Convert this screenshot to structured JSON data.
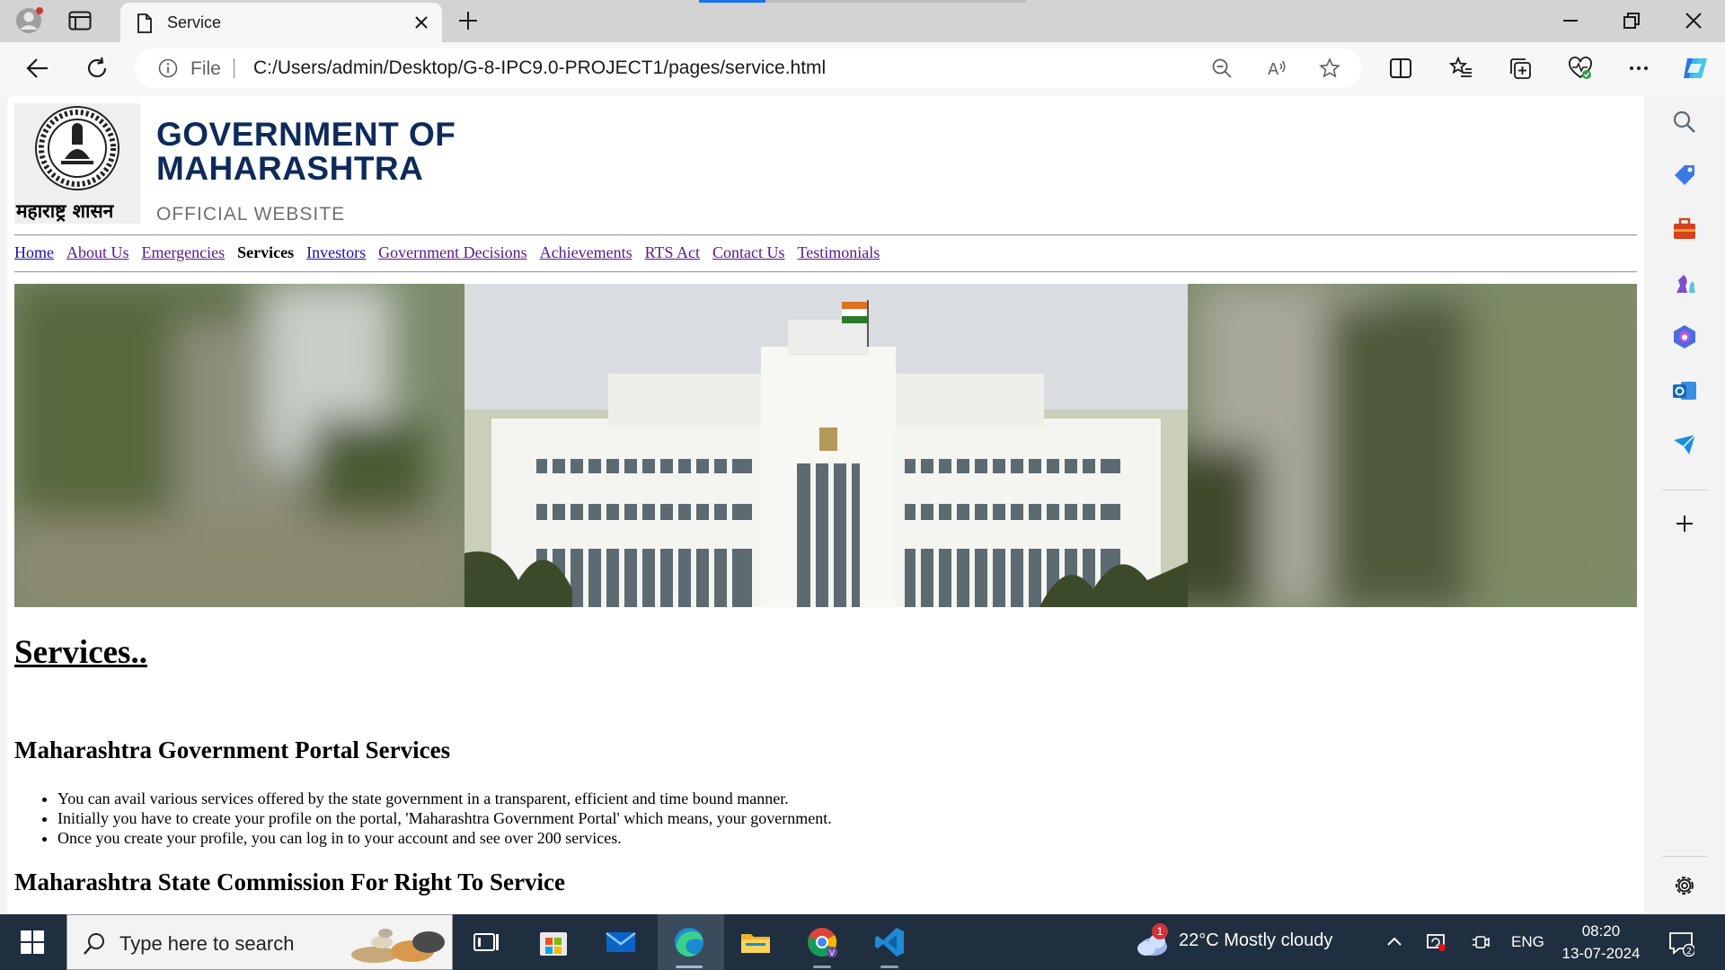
{
  "browser": {
    "tab_title": "Service",
    "address": {
      "scheme_label": "File",
      "url": "C:/Users/admin/Desktop/G-8-IPC9.0-PROJECT1/pages/service.html"
    }
  },
  "site": {
    "marathi_name": "महाराष्ट्र शासन",
    "title": "GOVERNMENT OF\nMAHARASHTRA",
    "subtitle": "OFFICIAL WEBSITE",
    "nav": [
      {
        "label": "Home"
      },
      {
        "label": "About Us"
      },
      {
        "label": "Emergencies"
      },
      {
        "label": "Services",
        "current": true
      },
      {
        "label": "Investors"
      },
      {
        "label": "Government Decisions"
      },
      {
        "label": "Achievements"
      },
      {
        "label": "RTS Act"
      },
      {
        "label": "Contact Us"
      },
      {
        "label": "Testimonials"
      }
    ]
  },
  "main": {
    "heading": "Services..",
    "section1": {
      "heading": "Maharashtra Government Portal Services",
      "bullets": [
        "You can avail various services offered by the state government in a transparent, efficient and time bound manner.",
        "Initially you have to create your profile on the portal, 'Maharashtra Government Portal' which means, your government.",
        "Once you create your profile, you can log in to your account and see over 200 services."
      ]
    },
    "section2": {
      "heading": "Maharashtra State Commission For Right To Service"
    }
  },
  "taskbar": {
    "search_placeholder": "Type here to search",
    "weather_badge": "1",
    "weather_text": "22°C  Mostly cloudy",
    "language": "ENG",
    "time": "08:20",
    "date": "13-07-2024",
    "notification_count": "2"
  },
  "colors": {
    "link": "#1a0dab",
    "visited_link": "#551a8b",
    "title_navy": "#0d2b5a",
    "taskbar": "#1f2f3f"
  }
}
